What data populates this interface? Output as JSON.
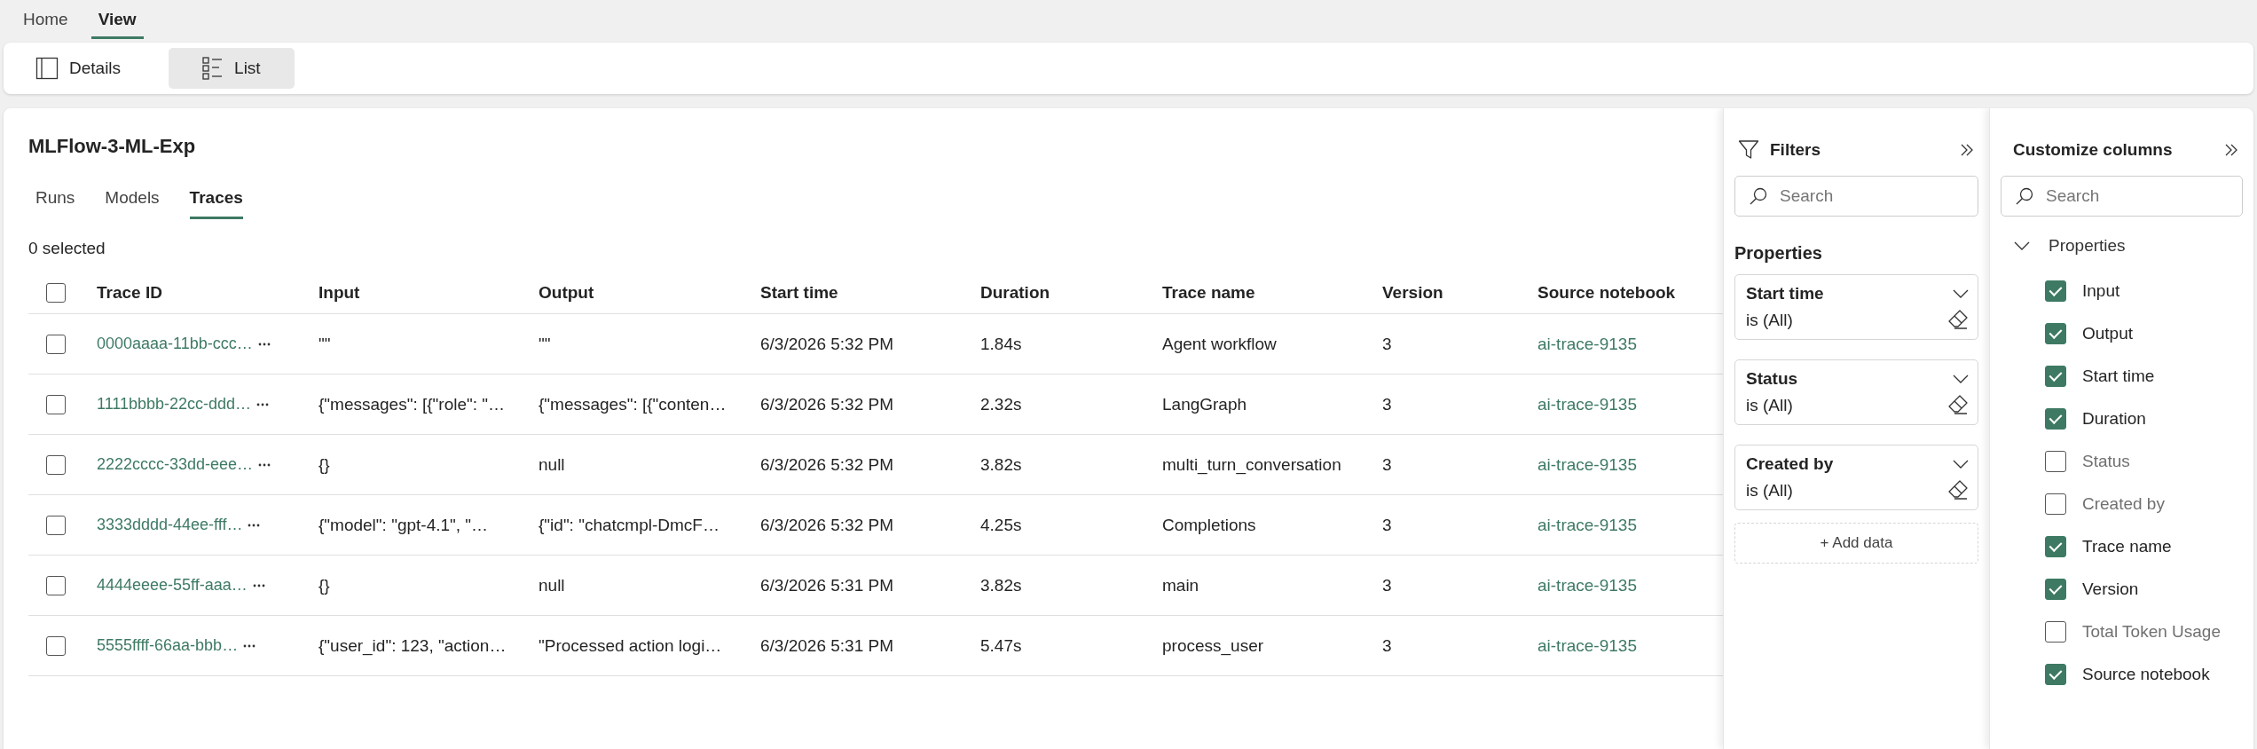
{
  "ribbon_tabs": [
    {
      "label": "Home",
      "selected": false
    },
    {
      "label": "View",
      "selected": true
    }
  ],
  "toolbar": [
    {
      "kind": "details",
      "label": "Details",
      "selected": false
    },
    {
      "kind": "list",
      "label": "List",
      "selected": true
    }
  ],
  "experiment": {
    "title": "MLFlow-3-ML-Exp"
  },
  "tabs": [
    {
      "label": "Runs",
      "selected": false
    },
    {
      "label": "Models",
      "selected": false
    },
    {
      "label": "Traces",
      "selected": true
    }
  ],
  "selection_count": "0 selected",
  "table": {
    "select_all_checked": false,
    "columns": [
      "Trace ID",
      "Input",
      "Output",
      "Start time",
      "Duration",
      "Trace name",
      "Version",
      "Source notebook"
    ],
    "rows": [
      {
        "checked": false,
        "cells": [
          "0000aaaa-11bb-ccc…",
          "\"\"",
          "\"\"",
          "6/3/2026 5:32 PM",
          "1.84s",
          "Agent workflow",
          "3",
          "ai-trace-9135"
        ]
      },
      {
        "checked": false,
        "cells": [
          "1111bbbb-22cc-ddd…",
          "{\"messages\": [{\"role\": \"…",
          "{\"messages\": [{\"conten…",
          "6/3/2026 5:32 PM",
          "2.32s",
          "LangGraph",
          "3",
          "ai-trace-9135"
        ]
      },
      {
        "checked": false,
        "cells": [
          "2222cccc-33dd-eee…",
          "{}",
          "null",
          "6/3/2026 5:32 PM",
          "3.82s",
          "multi_turn_conversation",
          "3",
          "ai-trace-9135"
        ]
      },
      {
        "checked": false,
        "cells": [
          "3333dddd-44ee-fff…",
          "{\"model\": \"gpt-4.1\", \"…",
          "{\"id\": \"chatcmpl-DmcF…",
          "6/3/2026 5:32 PM",
          "4.25s",
          "Completions",
          "3",
          "ai-trace-9135"
        ]
      },
      {
        "checked": false,
        "cells": [
          "4444eeee-55ff-aaa…",
          "{}",
          "null",
          "6/3/2026 5:31 PM",
          "3.82s",
          "main",
          "3",
          "ai-trace-9135"
        ]
      },
      {
        "checked": false,
        "cells": [
          "5555ffff-66aa-bbb…",
          "{\"user_id\": 123, \"action…",
          "\"Processed action logi…",
          "6/3/2026 5:31 PM",
          "5.47s",
          "process_user",
          "3",
          "ai-trace-9135"
        ]
      }
    ]
  },
  "filters": {
    "title": "Filters",
    "search": {
      "placeholder": "Search"
    },
    "section": "Properties",
    "cards": [
      {
        "label": "Start time",
        "value": "is (All)"
      },
      {
        "label": "Status",
        "value": "is (All)"
      },
      {
        "label": "Created by",
        "value": "is (All)"
      }
    ],
    "add_button": "+ Add data"
  },
  "customize": {
    "title": "Customize columns",
    "search": {
      "placeholder": "Search"
    },
    "group": {
      "label": "Properties",
      "expanded": true
    },
    "items": [
      {
        "label": "Input",
        "checked": true
      },
      {
        "label": "Output",
        "checked": true
      },
      {
        "label": "Start time",
        "checked": true
      },
      {
        "label": "Duration",
        "checked": true
      },
      {
        "label": "Status",
        "checked": false
      },
      {
        "label": "Created by",
        "checked": false
      },
      {
        "label": "Trace name",
        "checked": true
      },
      {
        "label": "Version",
        "checked": true
      },
      {
        "label": "Total Token Usage",
        "checked": false
      },
      {
        "label": "Source notebook",
        "checked": true
      }
    ]
  }
}
